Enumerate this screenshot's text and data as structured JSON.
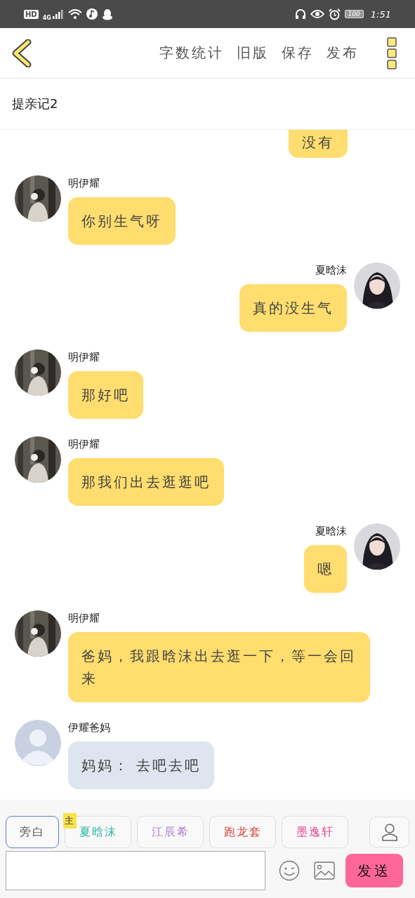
{
  "status_bar": {
    "network": "4G",
    "badge": "HD",
    "battery": "100",
    "time": "1:51"
  },
  "header": {
    "actions": [
      "字数统计",
      "旧版",
      "保存",
      "发布"
    ]
  },
  "title": "提亲记2",
  "messages": [
    {
      "kind": "outgoing",
      "text": "没有",
      "color": "#ffdd6e"
    },
    {
      "kind": "incoming",
      "name": "明伊耀",
      "text": "你别生气呀",
      "color": "#ffdd6e"
    },
    {
      "kind": "outgoing",
      "name": "夏晗沫",
      "text": "真的没生气",
      "color": "#ffdd6e"
    },
    {
      "kind": "incoming",
      "name": "明伊耀",
      "text": "那好吧",
      "color": "#ffdd6e"
    },
    {
      "kind": "incoming",
      "name": "明伊耀",
      "text": "那我们出去逛逛吧",
      "color": "#ffdd6e"
    },
    {
      "kind": "outgoing",
      "name": "夏晗沫",
      "text": "嗯",
      "color": "#ffdd6e"
    },
    {
      "kind": "incoming",
      "name": "明伊耀",
      "text": "爸妈，我跟晗沫出去逛一下，等一会回来",
      "color": "#ffdd6e"
    },
    {
      "kind": "guest",
      "name": "伊耀爸妈",
      "text": "妈妈： 去吧去吧",
      "color": "#dfe5ee"
    }
  ],
  "roles": [
    {
      "label": "旁白",
      "color": "#555555",
      "selected": true
    },
    {
      "label": "夏晗沫",
      "color": "#2bb5a5",
      "selected": false,
      "badge": "主"
    },
    {
      "label": "江辰希",
      "color": "#a77bd0",
      "selected": false
    },
    {
      "label": "跑龙套",
      "color": "#d0463a",
      "selected": false
    },
    {
      "label": "墨逸轩",
      "color": "#e0458e",
      "selected": false
    }
  ],
  "composer": {
    "send": "发送"
  }
}
